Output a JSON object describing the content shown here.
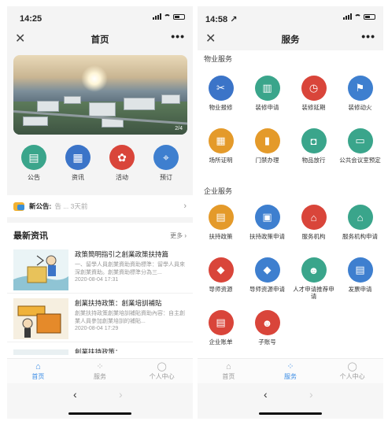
{
  "left": {
    "status": {
      "time": "14:25"
    },
    "nav": {
      "title": "首页",
      "close": "✕",
      "more": "•••"
    },
    "banner": {
      "counter": "2/4"
    },
    "quick": [
      {
        "label": "公告",
        "icon": "announcement-icon",
        "glyph": "▤",
        "color": "#3aa58b"
      },
      {
        "label": "资讯",
        "icon": "news-icon",
        "glyph": "▦",
        "color": "#3b74c8"
      },
      {
        "label": "活动",
        "icon": "gift-icon",
        "glyph": "✿",
        "color": "#d9453a"
      },
      {
        "label": "预订",
        "icon": "location-icon",
        "glyph": "⌖",
        "color": "#3e7fcf"
      }
    ],
    "notice": {
      "label": "新公告:",
      "text": "告 ... 3天前",
      "chev": "›"
    },
    "news": {
      "title": "最新资讯",
      "more": "更多 ›",
      "items": [
        {
          "title": "政策簡明指引之創業政策扶持篇",
          "desc": "一、留學人員創業資助資助標準：留學人員來深創業資助。創業資助標準分為三...",
          "time": "2020-08-04 17:31"
        },
        {
          "title": "創業扶持政策：創業培訓補貼",
          "desc": "創業扶持政策創業培訓補貼資助內容：自主創業人員參加創業培訓的補貼...",
          "time": "2020-08-04 17:29"
        },
        {
          "title": "創業扶持政策：...",
          "desc": "",
          "time": ""
        }
      ]
    },
    "tabs": [
      {
        "label": "首页",
        "glyph": "⌂",
        "icon": "home-icon"
      },
      {
        "label": "服务",
        "glyph": "⁘",
        "icon": "service-icon"
      },
      {
        "label": "个人中心",
        "glyph": "◯",
        "icon": "person-icon"
      }
    ],
    "browser": {
      "back": "‹",
      "forward": "›"
    }
  },
  "right": {
    "status": {
      "time": "14:58 ↗"
    },
    "nav": {
      "title": "服务",
      "close": "✕",
      "more": "•••"
    },
    "sections": [
      {
        "title": "物业服务",
        "items": [
          {
            "label": "物业报修",
            "icon": "repair-tools-icon",
            "glyph": "✂",
            "color": "#3b74c8"
          },
          {
            "label": "装修申请",
            "icon": "paint-roller-icon",
            "glyph": "▥",
            "color": "#3aa58b"
          },
          {
            "label": "装修延期",
            "icon": "document-clock-icon",
            "glyph": "◷",
            "color": "#d9453a"
          },
          {
            "label": "装修动火",
            "icon": "fire-extinguisher-icon",
            "glyph": "⚑",
            "color": "#3e7fcf"
          },
          {
            "label": "场所证明",
            "icon": "building-icon",
            "glyph": "▦",
            "color": "#e49a2a"
          },
          {
            "label": "门禁办理",
            "icon": "door-card-icon",
            "glyph": "▮",
            "color": "#e49a2a"
          },
          {
            "label": "物品放行",
            "icon": "package-icon",
            "glyph": "◘",
            "color": "#3aa58b"
          },
          {
            "label": "公共会议室预定",
            "icon": "meeting-board-icon",
            "glyph": "▭",
            "color": "#3aa58b"
          }
        ]
      },
      {
        "title": "企业服务",
        "items": [
          {
            "label": "扶持政策",
            "icon": "policy-doc-icon",
            "glyph": "▤",
            "color": "#e49a2a"
          },
          {
            "label": "扶持政策申请",
            "icon": "policy-apply-icon",
            "glyph": "▣",
            "color": "#3e7fcf"
          },
          {
            "label": "服务机构",
            "icon": "institution-icon",
            "glyph": "⌂",
            "color": "#d9453a"
          },
          {
            "label": "服务机构申请",
            "icon": "institution-apply-icon",
            "glyph": "⌂",
            "color": "#3aa58b"
          },
          {
            "label": "导师资源",
            "icon": "mentor-cap-icon",
            "glyph": "◆",
            "color": "#d9453a"
          },
          {
            "label": "导师资源申请",
            "icon": "mentor-apply-icon",
            "glyph": "◆",
            "color": "#3e7fcf"
          },
          {
            "label": "人才申请推荐申请",
            "icon": "talent-icon",
            "glyph": "☻",
            "color": "#3aa58b"
          },
          {
            "label": "发票申请",
            "icon": "invoice-icon",
            "glyph": "▤",
            "color": "#3e7fcf"
          },
          {
            "label": "企业账单",
            "icon": "bill-icon",
            "glyph": "▤",
            "color": "#d9453a"
          },
          {
            "label": "子账号",
            "icon": "sub-account-icon",
            "glyph": "☻",
            "color": "#d9453a"
          }
        ]
      }
    ],
    "tabs": [
      {
        "label": "首页",
        "glyph": "⌂",
        "icon": "home-icon"
      },
      {
        "label": "服务",
        "glyph": "⁘",
        "icon": "service-icon"
      },
      {
        "label": "个人中心",
        "glyph": "◯",
        "icon": "person-icon"
      }
    ],
    "browser": {
      "back": "‹",
      "forward": "›"
    }
  }
}
